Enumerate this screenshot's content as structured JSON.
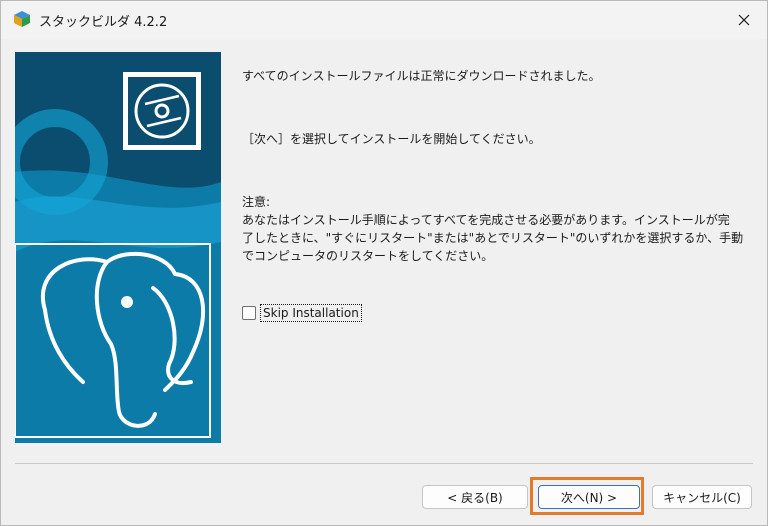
{
  "window": {
    "title": "スタックビルダ 4.2.2"
  },
  "messages": {
    "downloaded": "すべてのインストールファイルは正常にダウンロードされました。",
    "instruction": "［次へ］を選択してインストールを開始してください。",
    "note_title": "注意:",
    "note_body_1": "あなたはインストール手順によってすべてを完成させる必要があります。インストールが完",
    "note_body_2": "了したときに、\"すぐにリスタート\"または\"あとでリスタート\"のいずれかを選択するか、手動",
    "note_body_3": "でコンピュータのリスタートをしてください。"
  },
  "skip": {
    "label": "Skip Installation",
    "checked": false
  },
  "buttons": {
    "back": "< 戻る(B)",
    "next": "次へ(N) >",
    "cancel": "キャンセル(C)"
  },
  "colors": {
    "banner_blue": "#0d6f99",
    "banner_dark": "#0a4d6e",
    "highlight_orange": "#e37b2d"
  },
  "icons": {
    "app": "stack-builder-icon",
    "disc": "disc-icon",
    "elephant": "postgresql-elephant-icon",
    "close": "close-icon"
  }
}
